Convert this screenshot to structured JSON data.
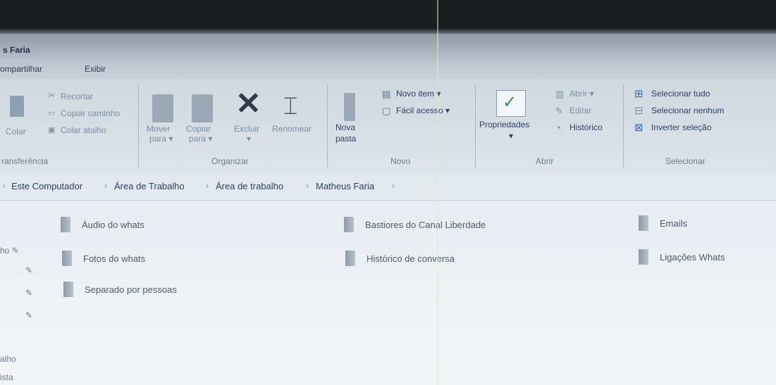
{
  "window": {
    "title": "s Faria"
  },
  "menu": {
    "items": [
      "ompartilhar",
      "Exibir"
    ]
  },
  "ribbon": {
    "clipboard": {
      "colar": "Colar",
      "recortar": "Recortar",
      "copiar_caminho": "Copiar caminho",
      "colar_atalho": "Colar atalho",
      "label": "ransferência"
    },
    "organize": {
      "mover": "Mover",
      "mover2": "para ▾",
      "copiar": "Copiar",
      "copiar2": "para ▾",
      "excluir": "Excluir",
      "excluir2": "▾",
      "renomear": "Renomear",
      "label": "Organizar"
    },
    "new": {
      "nova": "Nova",
      "pasta": "pasta",
      "novo_item": "Novo item ▾",
      "facil_acesso": "Fácil acesso ▾",
      "label": "Novo"
    },
    "open": {
      "propriedades": "Propriedades",
      "prop_arrow": "▾",
      "abrir": "Abrir ▾",
      "editar": "Editar",
      "historico": "Histórico",
      "label": "Abrir"
    },
    "select": {
      "selecionar_tudo": "Selecionar tudo",
      "selecionar_nenhum": "Selecionar nenhum",
      "inverter": "Inverter seleção",
      "label": "Selecionar"
    }
  },
  "breadcrumb": {
    "lead": "›",
    "items": [
      "Este Computador",
      "Área de Trabalho",
      "Área de trabalho",
      "Matheus Faria"
    ],
    "sep": "›"
  },
  "folders": [
    {
      "name": "Áudio do whats"
    },
    {
      "name": "Bastiores do Canal Liberdade"
    },
    {
      "name": "Emails"
    },
    {
      "name": "Fotos do whats"
    },
    {
      "name": "Histórico de conversa"
    },
    {
      "name": "Ligações Whats"
    },
    {
      "name": "Separado por pessoas"
    }
  ],
  "nav_fragments": [
    "ho ✎",
    "✎",
    "✎",
    "✎",
    "alho",
    "ista"
  ]
}
